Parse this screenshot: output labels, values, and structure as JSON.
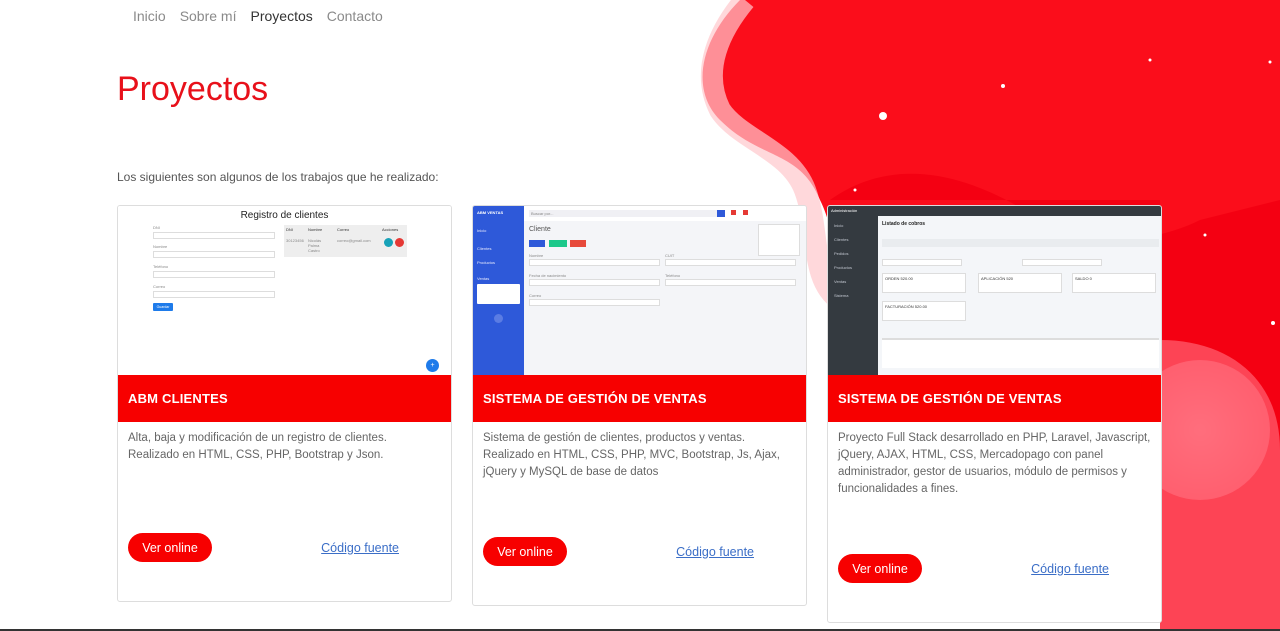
{
  "nav": {
    "items": [
      "Inicio",
      "Sobre mí",
      "Proyectos",
      "Contacto"
    ],
    "active": "Proyectos"
  },
  "page": {
    "title": "Proyectos",
    "intro": "Los siguientes son algunos de los trabajos que he realizado:"
  },
  "colors": {
    "accent": "#f70000",
    "title": "#e8101a",
    "link": "#3b6ec7"
  },
  "cards": [
    {
      "title": "ABM CLIENTES",
      "description": "Alta, baja y modificación de un registro de clientes. Realizado en HTML, CSS, PHP, Bootstrap y Json.",
      "button": "Ver online",
      "link": "Código fuente",
      "preview": {
        "heading": "Registro de clientes",
        "fields": [
          "DNI",
          "Nombre",
          "Teléfono",
          "Correo"
        ],
        "submit": "Guardar",
        "table_headers": [
          "DNI",
          "Nombre",
          "Correo",
          "Acciones"
        ],
        "row": [
          "30123456",
          "Nicolás Palma Castro",
          "correo@gmail.com"
        ]
      }
    },
    {
      "title": "SISTEMA DE GESTIÓN DE VENTAS",
      "description": "Sistema de gestión de clientes, productos y ventas. Realizado en HTML, CSS, PHP, MVC, Bootstrap, Js, Ajax, jQuery y MySQL de base de datos",
      "button": "Ver online",
      "link": "Código fuente",
      "preview": {
        "brand": "ABM VENTAS",
        "search": "Buscar por...",
        "heading": "Cliente",
        "buttons": [
          "Nuevo",
          "Guardar",
          "Borrar"
        ],
        "menu": [
          "Inicio",
          "Clientes",
          "Productos",
          "Ventas"
        ],
        "fields": [
          "Nombre",
          "CUIT",
          "Fecha de nacimiento",
          "Teléfono",
          "Correo"
        ]
      }
    },
    {
      "title": "SISTEMA DE GESTIÓN DE VENTAS",
      "description": "Proyecto Full Stack desarrollado en PHP, Laravel, Javascript, jQuery, AJAX, HTML, CSS, Mercadopago con panel administrador, gestor de usuarios, módulo de permisos y funcionalidades a fines.",
      "button": "Ver online",
      "link": "Código fuente",
      "preview": {
        "brand": "Administración",
        "heading": "Listado de cobros",
        "menu": [
          "Inicio",
          "Clientes",
          "Pedidos",
          "Productos",
          "Ventas",
          "Sistema"
        ],
        "boxes": [
          "ORDEN 520.00",
          "APLICACIÓN 520",
          "SALDO 0",
          "FACTURACIÓN 520.00"
        ]
      }
    }
  ]
}
